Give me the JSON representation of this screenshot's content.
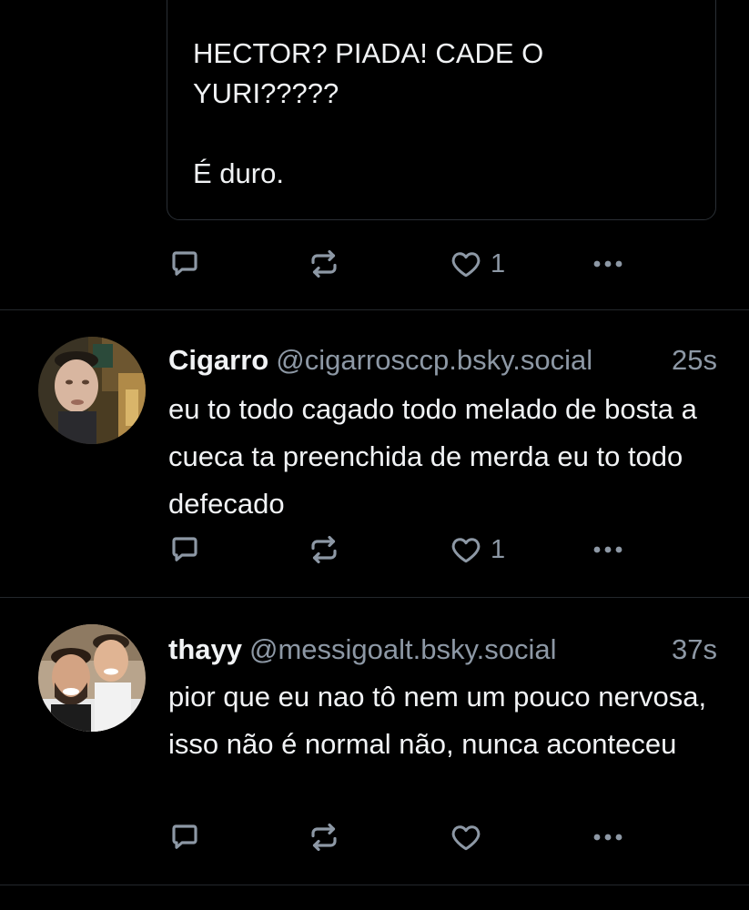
{
  "quoted": {
    "text": "HECTOR? PIADA! CADE O\nYURI?????\n\nÉ duro."
  },
  "quoted_actions": {
    "like_count": "1"
  },
  "posts": [
    {
      "display_name": "Cigarro",
      "handle": "@cigarrosccp.bsky.social",
      "timestamp": "25s",
      "text": "eu to todo cagado todo melado de bosta a cueca ta preenchida de merda eu to todo defecado",
      "like_count": "1"
    },
    {
      "display_name": "thayy",
      "handle": "@messigoalt.bsky.social",
      "timestamp": "37s",
      "text": "pior que eu nao tô nem um pouco nervosa, isso não é normal não, nunca aconteceu",
      "like_count": ""
    }
  ],
  "colors": {
    "background": "#000000",
    "text": "#f1f3f5",
    "muted": "#8d98a5",
    "divider": "#23272c"
  },
  "icons": {
    "reply": "speech-bubble-icon",
    "repost": "repost-arrows-icon",
    "like": "heart-outline-icon",
    "more": "ellipsis-icon"
  }
}
